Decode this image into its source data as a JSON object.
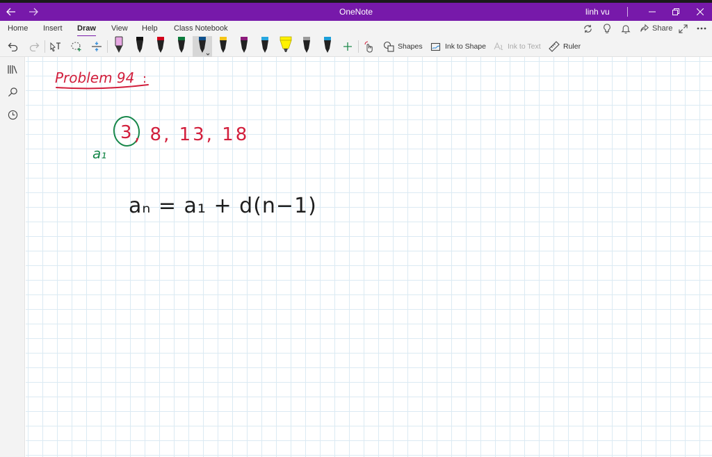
{
  "window": {
    "title": "OneNote",
    "user": "linh vu"
  },
  "tabs": [
    {
      "label": "Home",
      "active": false
    },
    {
      "label": "Insert",
      "active": false
    },
    {
      "label": "Draw",
      "active": true
    },
    {
      "label": "View",
      "active": false
    },
    {
      "label": "Help",
      "active": false
    },
    {
      "label": "Class Notebook",
      "active": false
    }
  ],
  "ribbon_right": {
    "share_label": "Share"
  },
  "toolbar": {
    "shapes_label": "Shapes",
    "ink_to_shape_label": "Ink to Shape",
    "ink_to_text_label": "Ink to Text",
    "ruler_label": "Ruler"
  },
  "pens": [
    {
      "kind": "pencil",
      "color": "#e7a9e3"
    },
    {
      "kind": "pen",
      "color": "#111111"
    },
    {
      "kind": "pen",
      "color": "#d0021b"
    },
    {
      "kind": "pen",
      "color": "#0b7a3b"
    },
    {
      "kind": "pen",
      "color": "#0d4f8b",
      "selected": true
    },
    {
      "kind": "pen",
      "color": "#f5c518"
    },
    {
      "kind": "pen",
      "color": "#8b1a7a"
    },
    {
      "kind": "pen",
      "color": "#28a7e0"
    },
    {
      "kind": "highlighter",
      "color": "#fff200"
    },
    {
      "kind": "pen",
      "color": "#9b9b9b"
    },
    {
      "kind": "pen",
      "color": "#1c9fd8"
    }
  ],
  "colors": {
    "accent": "#7719aa",
    "ink_red": "#d21f3c",
    "ink_green": "#17874a",
    "ink_black": "#1e1e1e"
  },
  "page": {
    "heading": "Problem 94",
    "heading_suffix": ":",
    "sequence_first": "3",
    "sequence_rest": ", 8, 13, 18",
    "first_term_label": "a₁",
    "formula": "aₙ = a₁ + d(n−1)"
  }
}
